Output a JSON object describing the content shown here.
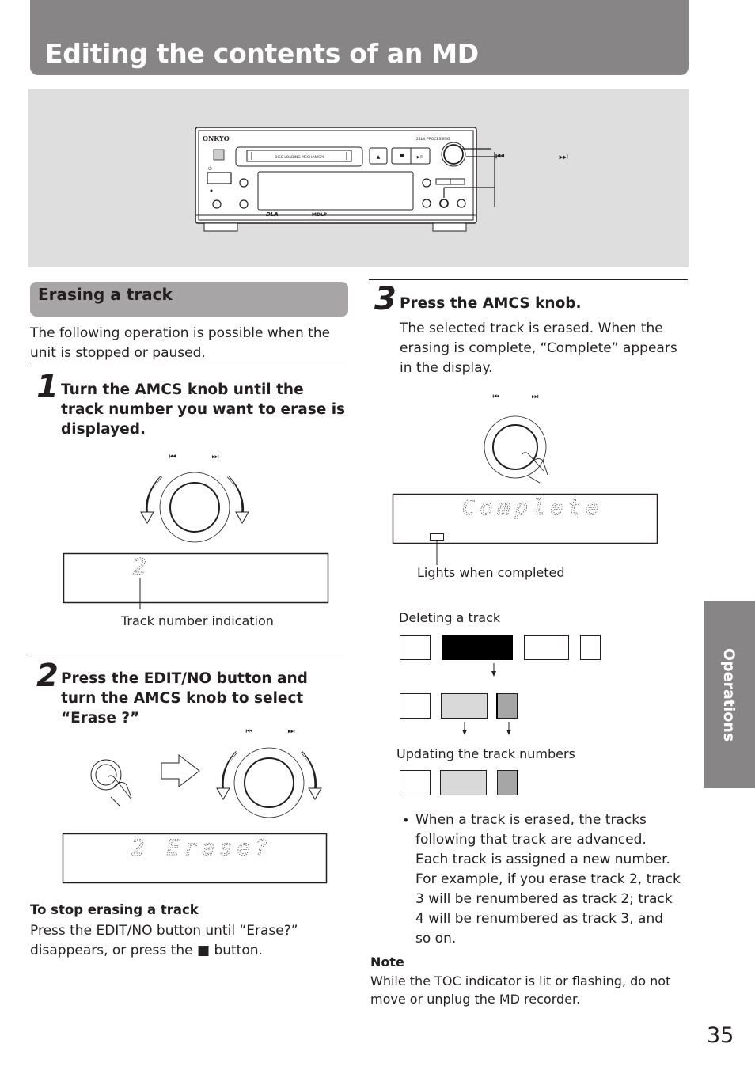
{
  "header": {
    "title": "Editing the contents of an MD",
    "colors": {
      "title_bar": "#878586",
      "section_bar": "#a7a5a6",
      "device_panel_bg": "#dedede"
    }
  },
  "device": {
    "brand": "ONKYO",
    "slot_label": "DISC LOADING MECHANISM",
    "processing_label": "24bit PROCESSING",
    "logo_bottom": "MDLP",
    "dla_label": "DLA",
    "callout_prev_icon": "previous-track-icon",
    "callout_next_icon": "next-track-icon",
    "callout_prev_glyph": "⏮",
    "callout_next_glyph": "⏭"
  },
  "section": {
    "title": "Erasing a track",
    "intro": "The following operation is possible when the unit is stopped or paused."
  },
  "steps": [
    {
      "number": "1",
      "title": "Turn the AMCS knob until the track number you want to erase is displayed.",
      "display": "2",
      "callout": "Track number indication"
    },
    {
      "number": "2",
      "title": "Press the EDIT/NO button and turn the AMCS knob to select “Erase ?”",
      "display": "2 Erase?"
    },
    {
      "number": "3",
      "title": "Press the AMCS knob.",
      "text": "The selected track is erased. When the erasing is complete, “Complete” appears in the display.",
      "display": "Complete",
      "callout": "Lights when completed"
    }
  ],
  "stop": {
    "title": "To stop erasing a track",
    "text_before": "Press the EDIT/NO button until “Erase?” disappears, or press the",
    "stop_glyph": "■",
    "text_after": "button."
  },
  "diagram": {
    "deleting_label": "Deleting a track",
    "updating_label": "Updating the track numbers",
    "colors": {
      "deleted": "#000000",
      "moved_light": "#d9d9d9",
      "moved_dark": "#a6a6a6",
      "normal": "#ffffff"
    }
  },
  "bullet": "When a track is erased, the tracks following that track are advanced. Each track is assigned a new number. For example, if you erase track 2, track 3 will be renumbered as track 2; track 4 will be renumbered as track 3, and so on.",
  "note": {
    "title": "Note",
    "text": "While the TOC indicator is lit or flashing, do not move or unplug the MD recorder."
  },
  "side_tab": "Operations",
  "page_number": "35",
  "knob_icons": {
    "prev": "⏮",
    "next": "⏭"
  }
}
